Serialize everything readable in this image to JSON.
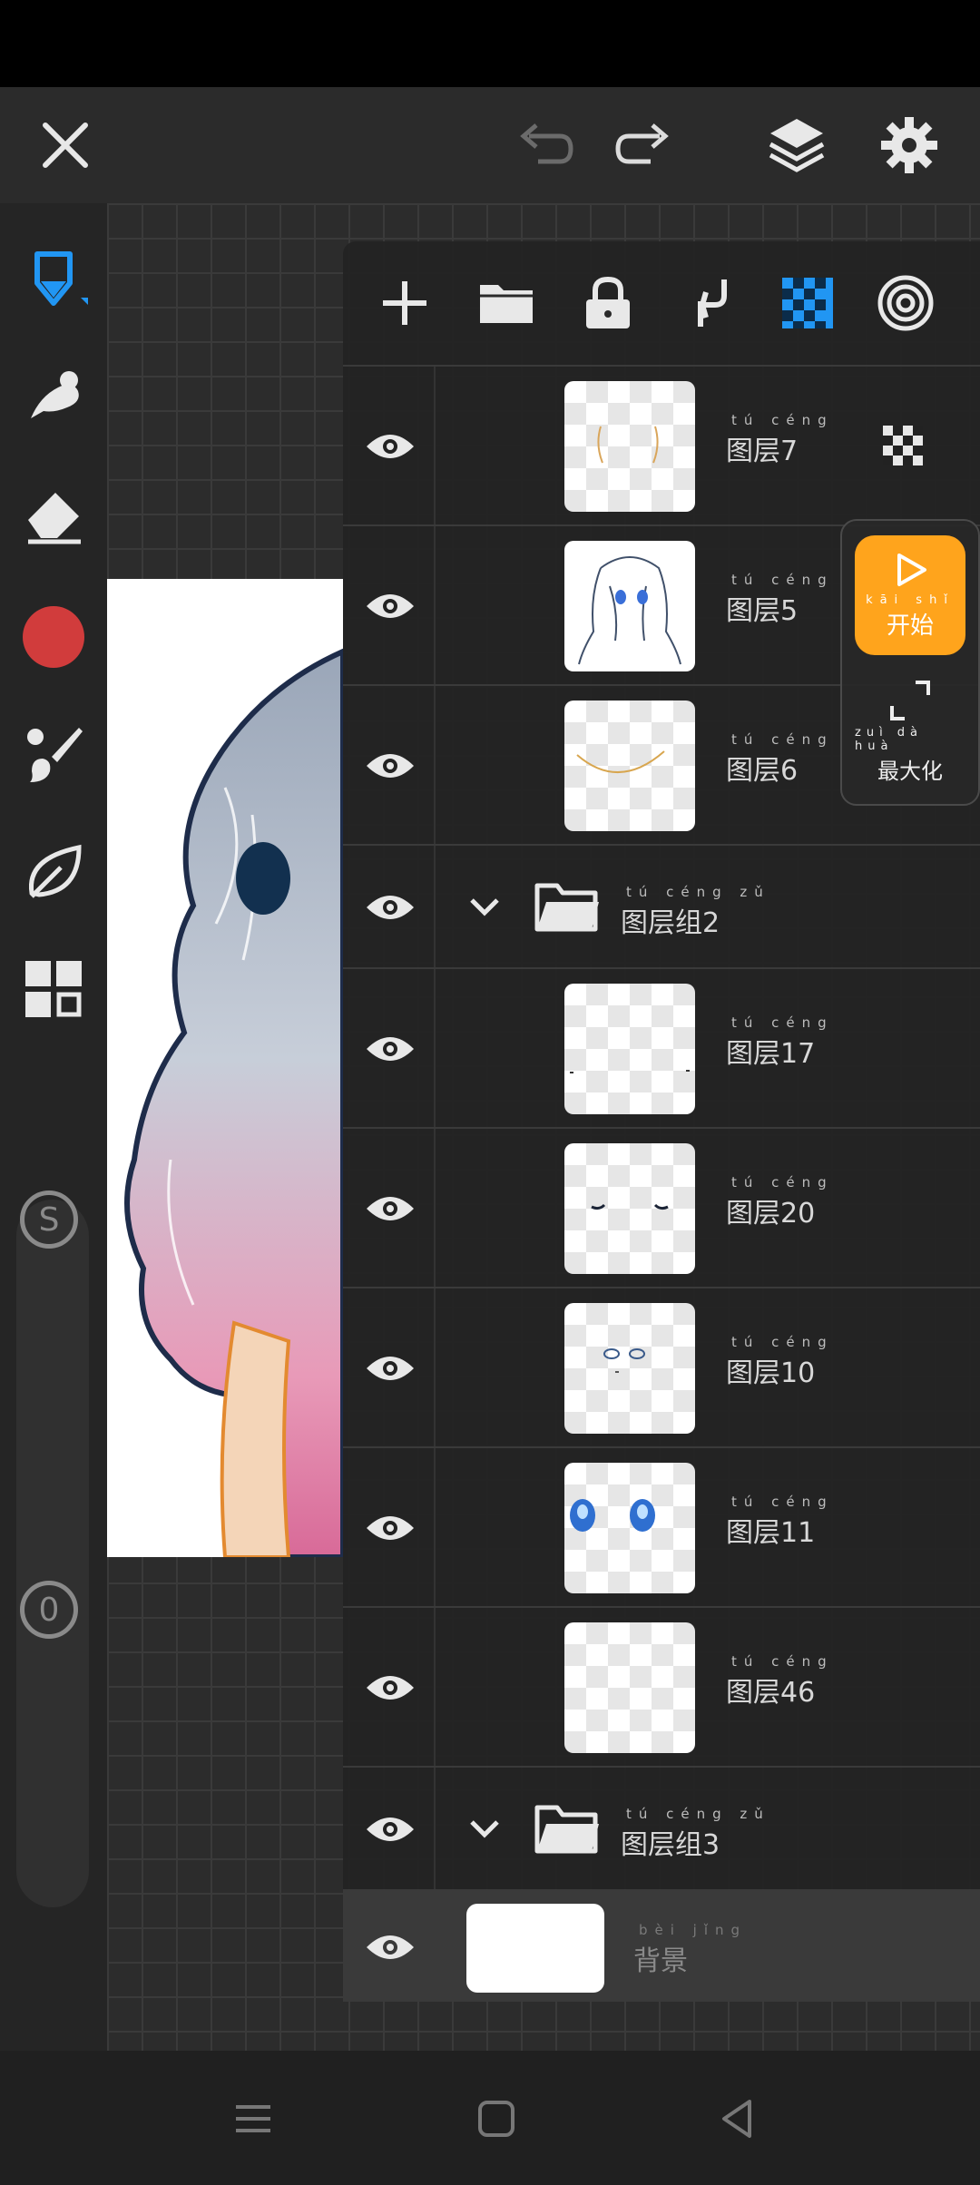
{
  "colors": {
    "accent_blue": "#2196f3",
    "start_orange": "#ffa41c",
    "brush_red": "#d13c3c",
    "panel_bg": "#222222"
  },
  "top_bar": {
    "icons": [
      "close-icon",
      "undo-icon",
      "redo-icon",
      "layers-icon",
      "settings-icon"
    ]
  },
  "left_toolbar": {
    "tools": [
      "pen-icon",
      "smudge-icon",
      "eraser-icon",
      "color-swatch",
      "brush-icon",
      "leaf-icon",
      "grid-icon"
    ],
    "size_label": "S",
    "opacity_label": "0"
  },
  "layers_panel": {
    "toolbar_icons": [
      "add-icon",
      "folder-icon",
      "lock-icon",
      "merge-down-icon",
      "checkerboard-icon",
      "target-icon"
    ],
    "layers": [
      {
        "type": "layer",
        "pinyin": "tú céng",
        "name": "图层7"
      },
      {
        "type": "layer",
        "pinyin": "tú céng",
        "name": "图层5"
      },
      {
        "type": "layer",
        "pinyin": "tú céng",
        "name": "图层6"
      },
      {
        "type": "group",
        "pinyin": "tú céng zǔ",
        "name": "图层组2"
      },
      {
        "type": "layer",
        "pinyin": "tú céng",
        "name": "图层17"
      },
      {
        "type": "layer",
        "pinyin": "tú céng",
        "name": "图层20"
      },
      {
        "type": "layer",
        "pinyin": "tú céng",
        "name": "图层10"
      },
      {
        "type": "layer",
        "pinyin": "tú céng",
        "name": "图层11"
      },
      {
        "type": "layer",
        "pinyin": "tú céng",
        "name": "图层46"
      },
      {
        "type": "group",
        "pinyin": "tú céng zǔ",
        "name": "图层组3"
      },
      {
        "type": "background",
        "pinyin": "bèi jǐng",
        "name": "背景"
      }
    ]
  },
  "float_panel": {
    "start_pinyin": "kāi shǐ",
    "start_label": "开始",
    "maximize_pinyin": "zuì dà huà",
    "maximize_label": "最大化"
  },
  "nav_bar": {
    "icons": [
      "menu-icon",
      "home-icon",
      "back-icon"
    ]
  }
}
